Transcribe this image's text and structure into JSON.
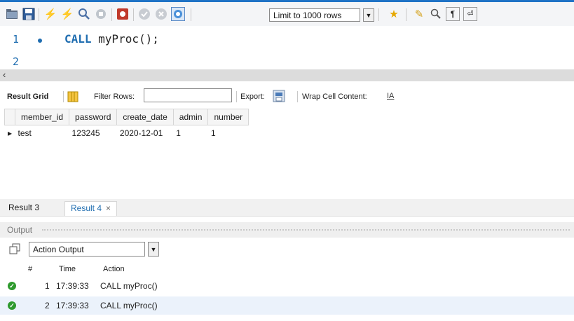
{
  "toolbar": {
    "limit_value": "Limit to 1000 rows",
    "icons": [
      "open-folder-icon",
      "save-icon",
      "execute-lightning-icon",
      "execute-cursor-lightning-icon",
      "explain-magnifier-icon",
      "stop-icon",
      "toggle-error-icon",
      "commit-icon",
      "rollback-icon",
      "autocommit-icon",
      "bookmark-star-icon",
      "beautify-broom-icon",
      "find-icon",
      "invisible-chars-icon",
      "wrap-icon"
    ]
  },
  "editor": {
    "lines": [
      {
        "number": "1",
        "keyword": "CALL",
        "rest": " myProc();"
      },
      {
        "number": "2",
        "keyword": "",
        "rest": ""
      }
    ]
  },
  "result_toolbar": {
    "result_grid_label": "Result Grid",
    "filter_rows_label": "Filter Rows:",
    "filter_value": "",
    "export_label": "Export:",
    "wrap_label": "Wrap Cell Content:"
  },
  "grid": {
    "columns": [
      "member_id",
      "password",
      "create_date",
      "admin",
      "number"
    ],
    "rows": [
      [
        "test",
        "123245",
        "2020-12-01",
        "1",
        "1"
      ]
    ]
  },
  "result_tabs": [
    {
      "label": "Result 3",
      "active": false
    },
    {
      "label": "Result 4",
      "active": true,
      "close": "×"
    }
  ],
  "output": {
    "title": "Output",
    "selector_value": "Action Output",
    "columns": {
      "num": "#",
      "time": "Time",
      "action": "Action"
    },
    "rows": [
      {
        "num": "1",
        "time": "17:39:33",
        "action": "CALL myProc()"
      },
      {
        "num": "2",
        "time": "17:39:33",
        "action": "CALL myProc()"
      }
    ]
  },
  "colors": {
    "accent": "#1f73c6",
    "keyword": "#1f6db0",
    "success": "#2e9a2e",
    "row_highlight": "#ebf2fb"
  }
}
